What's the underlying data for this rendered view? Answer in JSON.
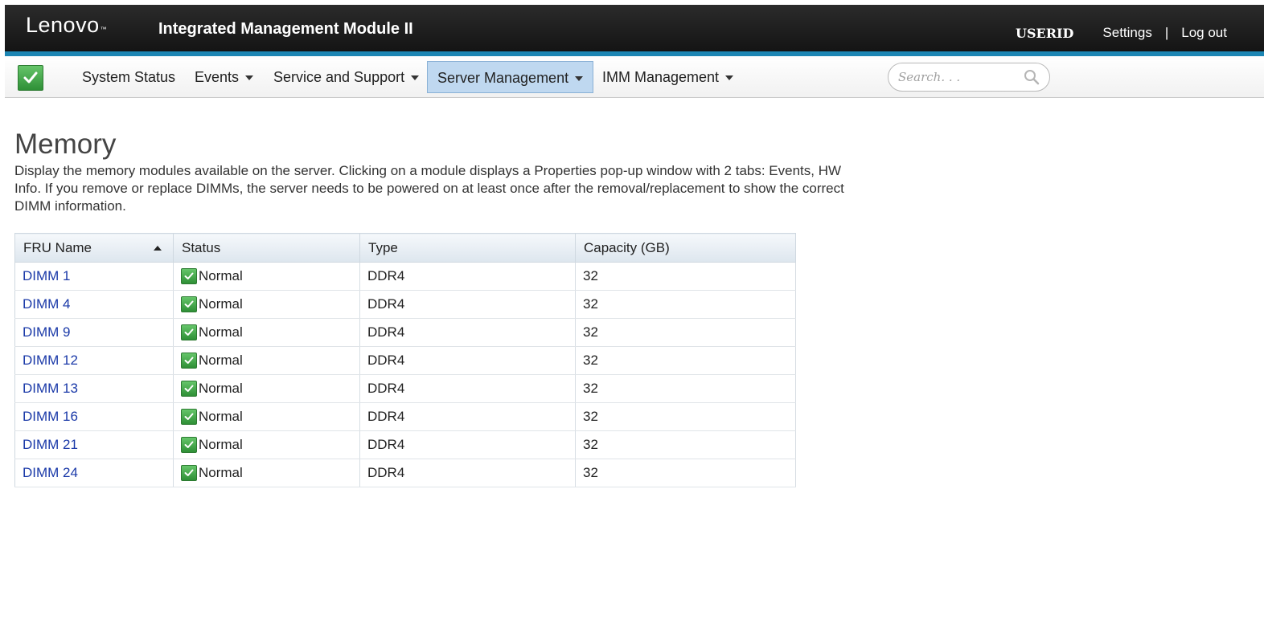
{
  "header": {
    "logo": "Lenovo",
    "logo_mark": "™",
    "app_title": "Integrated Management Module II",
    "user_id": "USERID",
    "settings_label": "Settings",
    "separator": "|",
    "logout_label": "Log out"
  },
  "nav": {
    "system_status_icon": "check-icon",
    "items": [
      {
        "label": "System Status",
        "has_menu": false
      },
      {
        "label": "Events",
        "has_menu": true
      },
      {
        "label": "Service and Support",
        "has_menu": true
      },
      {
        "label": "Server Management",
        "has_menu": true,
        "active": true
      },
      {
        "label": "IMM Management",
        "has_menu": true
      }
    ],
    "search_placeholder": "Search. . ."
  },
  "page": {
    "title": "Memory",
    "description": "Display the memory modules available on the server. Clicking on a module displays a Properties pop-up window with 2 tabs: Events, HW Info. If you remove or replace DIMMs, the server needs to be powered on at least once after the removal/replacement to show the correct DIMM information."
  },
  "table": {
    "columns": [
      "FRU Name",
      "Status",
      "Type",
      "Capacity (GB)"
    ],
    "sort": {
      "column": "FRU Name",
      "direction": "ascending"
    },
    "rows": [
      {
        "fru": "DIMM 1",
        "status": "Normal",
        "type": "DDR4",
        "capacity": "32"
      },
      {
        "fru": "DIMM 4",
        "status": "Normal",
        "type": "DDR4",
        "capacity": "32"
      },
      {
        "fru": "DIMM 9",
        "status": "Normal",
        "type": "DDR4",
        "capacity": "32"
      },
      {
        "fru": "DIMM 12",
        "status": "Normal",
        "type": "DDR4",
        "capacity": "32"
      },
      {
        "fru": "DIMM 13",
        "status": "Normal",
        "type": "DDR4",
        "capacity": "32"
      },
      {
        "fru": "DIMM 16",
        "status": "Normal",
        "type": "DDR4",
        "capacity": "32"
      },
      {
        "fru": "DIMM 21",
        "status": "Normal",
        "type": "DDR4",
        "capacity": "32"
      },
      {
        "fru": "DIMM 24",
        "status": "Normal",
        "type": "DDR4",
        "capacity": "32"
      }
    ]
  },
  "colors": {
    "header_bg": "#1a1a1a",
    "accent": "#1c86b4",
    "active_tab": "#bfd8f0",
    "status_ok": "#3aa541",
    "link": "#1a39a8"
  }
}
